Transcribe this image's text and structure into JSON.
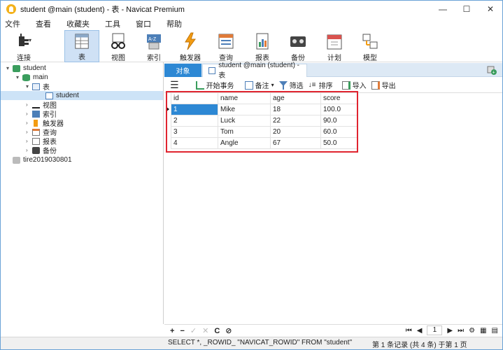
{
  "window": {
    "title": "student @main (student) - 表 - Navicat Premium",
    "min": "—",
    "max": "☐",
    "close": "✕"
  },
  "menu": [
    "文件",
    "查看",
    "收藏夹",
    "工具",
    "窗口",
    "帮助"
  ],
  "toolbar": [
    {
      "label": "连接",
      "icon": "connect-icon"
    },
    {
      "label": "表",
      "icon": "table-icon",
      "active": true
    },
    {
      "label": "视图",
      "icon": "view-icon"
    },
    {
      "label": "索引",
      "icon": "index-icon"
    },
    {
      "label": "触发器",
      "icon": "trigger-icon"
    },
    {
      "label": "查询",
      "icon": "query-icon"
    },
    {
      "label": "报表",
      "icon": "report-icon"
    },
    {
      "label": "备份",
      "icon": "backup-icon"
    },
    {
      "label": "计划",
      "icon": "schedule-icon"
    },
    {
      "label": "模型",
      "icon": "model-icon"
    }
  ],
  "tree": [
    {
      "label": "student",
      "icon": "connection-icon",
      "arrow": "▾"
    },
    {
      "label": "main",
      "icon": "database-icon",
      "arrow": "▾"
    },
    {
      "label": "表",
      "icon": "tables-icon",
      "arrow": "▾"
    },
    {
      "label": "student",
      "icon": "table-icon",
      "arrow": ""
    },
    {
      "label": "视图",
      "icon": "views-icon",
      "arrow": "›"
    },
    {
      "label": "索引",
      "icon": "indexes-icon",
      "arrow": "›"
    },
    {
      "label": "触发器",
      "icon": "triggers-icon",
      "arrow": "›"
    },
    {
      "label": "查询",
      "icon": "queries-icon",
      "arrow": "›"
    },
    {
      "label": "报表",
      "icon": "reports-icon",
      "arrow": "›"
    },
    {
      "label": "备份",
      "icon": "backups-icon",
      "arrow": "›"
    },
    {
      "label": "tire2019030801",
      "icon": "connection-icon",
      "arrow": ""
    }
  ],
  "tabs": {
    "objects": "对象",
    "data": "student @main (student) - 表"
  },
  "subtoolbar": {
    "begin_tx": "开始事务",
    "memo": "备注",
    "filter": "筛选",
    "sort": "排序",
    "import": "导入",
    "export": "导出"
  },
  "table": {
    "columns": [
      "id",
      "name",
      "age",
      "score"
    ],
    "rows": [
      [
        "1",
        "Mike",
        "18",
        "100.0"
      ],
      [
        "2",
        "Luck",
        "22",
        "90.0"
      ],
      [
        "3",
        "Tom",
        "20",
        "60.0"
      ],
      [
        "4",
        "Angle",
        "67",
        "50.0"
      ]
    ]
  },
  "bottombar": {
    "add": "+",
    "remove": "−",
    "apply": "✓",
    "cancel": "✕",
    "refresh": "C",
    "stop": "⊘",
    "page": "1"
  },
  "status": {
    "sql": "SELECT *, _ROWID_ \"NAVICAT_ROWID\" FROM \"student\"",
    "count": "第 1 条记录 (共 4 条) 于第 1 页"
  },
  "colors": {
    "accent": "#2d88d4",
    "highlight": "#e0242f",
    "selected_tree": "#cde3f7"
  }
}
